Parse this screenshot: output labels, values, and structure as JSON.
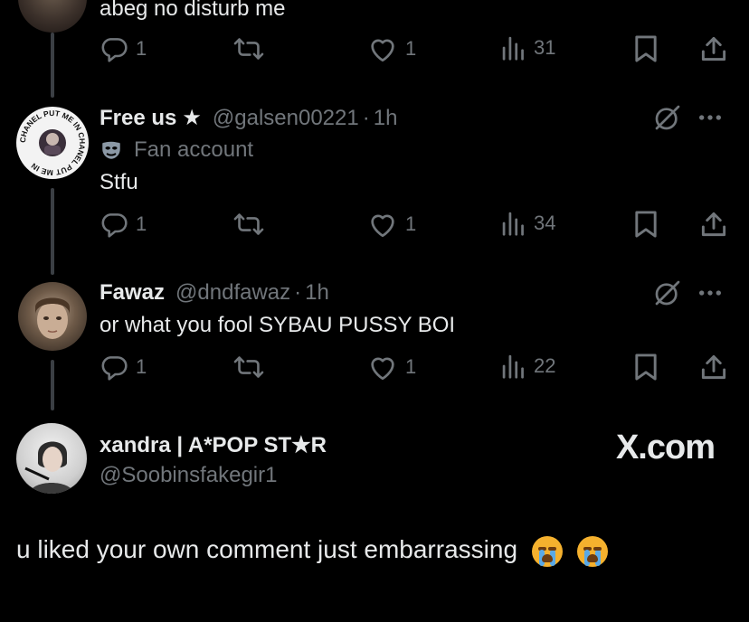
{
  "post0": {
    "text": "abeg no disturb me",
    "replies": "1",
    "likes": "1",
    "views": "31"
  },
  "post1": {
    "display_name": "Free us",
    "star": "★",
    "handle": "@galsen00221",
    "dot": "·",
    "time": "1h",
    "fan_label": "Fan account",
    "avatar_ring_text": "CHANEL PUT ME IN CHANEL PUT ME IN",
    "text": "Stfu",
    "replies": "1",
    "likes": "1",
    "views": "34"
  },
  "post2": {
    "display_name": "Fawaz",
    "handle": "@dndfawaz",
    "dot": "·",
    "time": "1h",
    "text": "or what you fool SYBAU PUSSY BOI",
    "replies": "1",
    "likes": "1",
    "views": "22"
  },
  "quote": {
    "display_name": "xandra | A*POP ST★R",
    "handle": "@Soobinsfakegir1",
    "brand": "X.com",
    "text": "u liked your own comment just embarrassing"
  },
  "icons": {
    "reply": "reply-icon",
    "retweet": "retweet-icon",
    "like": "heart-icon",
    "views": "views-icon",
    "bookmark": "bookmark-icon",
    "share": "share-icon",
    "grok": "grok-icon",
    "more": "more-icon",
    "mask": "mask-icon",
    "emoji": "loudly-crying-face-icon"
  },
  "colors": {
    "background": "#000000",
    "primary_text": "#e7e9ea",
    "secondary_text": "#71767b",
    "thread_line": "#3b3f44"
  }
}
